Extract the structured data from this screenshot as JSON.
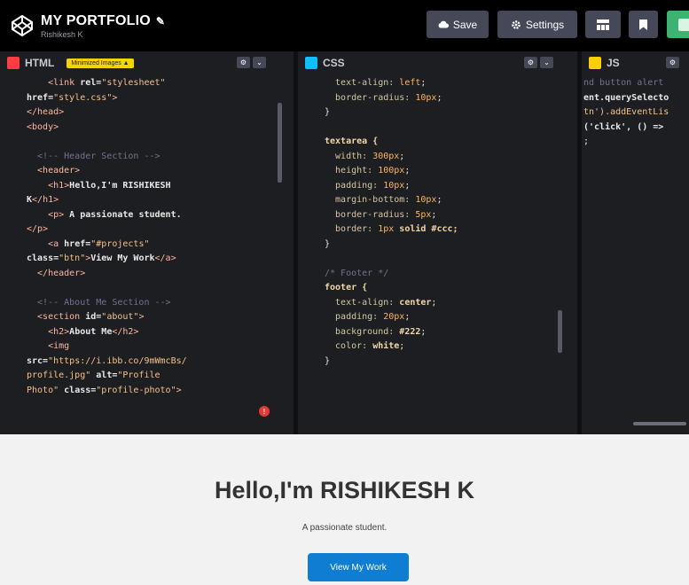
{
  "header": {
    "title": "MY PORTFOLIO",
    "pencil": "✎",
    "subtitle": "Rishikesh K",
    "save_label": "Save",
    "settings_label": "Settings",
    "save_icon": "cloud-icon",
    "settings_icon": "gear-icon"
  },
  "panes": {
    "html": {
      "label": "HTML",
      "chip": "Minimized Images ▲",
      "icon_color": "#ff3c41"
    },
    "css": {
      "label": "CSS",
      "icon_color": "#0ebeff"
    },
    "js": {
      "label": "JS",
      "icon_color": "#fcd000"
    }
  },
  "html_code": [
    [
      {
        "t": "    <link ",
        "c": "tag"
      },
      {
        "t": "rel=",
        "c": "attr"
      },
      {
        "t": "\"stylesheet\"",
        "c": "val"
      }
    ],
    [
      {
        "t": "href=",
        "c": "attr"
      },
      {
        "t": "\"style.css\"",
        "c": "val"
      },
      {
        "t": ">",
        "c": "tag"
      }
    ],
    [
      {
        "t": "</head>",
        "c": "tag"
      }
    ],
    [
      {
        "t": "<body>",
        "c": "tag"
      }
    ],
    [
      {
        "t": "",
        "c": "txt"
      }
    ],
    [
      {
        "t": "  <!-- Header Section -->",
        "c": "cmt"
      }
    ],
    [
      {
        "t": "  <header>",
        "c": "tag"
      }
    ],
    [
      {
        "t": "    <h1>",
        "c": "tag"
      },
      {
        "t": "Hello,I'm RISHIKESH",
        "c": "attr"
      }
    ],
    [
      {
        "t": "K",
        "c": "attr"
      },
      {
        "t": "</h1>",
        "c": "tag"
      }
    ],
    [
      {
        "t": "    <p>",
        "c": "tag"
      },
      {
        "t": " A passionate student.",
        "c": "attr"
      }
    ],
    [
      {
        "t": "</p>",
        "c": "tag"
      }
    ],
    [
      {
        "t": "    <a ",
        "c": "tag"
      },
      {
        "t": "href=",
        "c": "attr"
      },
      {
        "t": "\"#projects\"",
        "c": "val"
      }
    ],
    [
      {
        "t": "class=",
        "c": "attr"
      },
      {
        "t": "\"btn\"",
        "c": "val"
      },
      {
        "t": ">",
        "c": "tag"
      },
      {
        "t": "View My Work",
        "c": "attr"
      },
      {
        "t": "</a>",
        "c": "tag"
      }
    ],
    [
      {
        "t": "  </header>",
        "c": "tag"
      }
    ],
    [
      {
        "t": "",
        "c": "txt"
      }
    ],
    [
      {
        "t": "  <!-- About Me Section -->",
        "c": "cmt"
      }
    ],
    [
      {
        "t": "  <section ",
        "c": "tag"
      },
      {
        "t": "id=",
        "c": "attr"
      },
      {
        "t": "\"about\"",
        "c": "val"
      },
      {
        "t": ">",
        "c": "tag"
      }
    ],
    [
      {
        "t": "    <h2>",
        "c": "tag"
      },
      {
        "t": "About Me",
        "c": "attr"
      },
      {
        "t": "</h2>",
        "c": "tag"
      }
    ],
    [
      {
        "t": "    <img",
        "c": "tag"
      }
    ],
    [
      {
        "t": "src=",
        "c": "attr"
      },
      {
        "t": "\"https://i.ibb.co/9mWmcBs/",
        "c": "val"
      }
    ],
    [
      {
        "t": "profile.jpg\" ",
        "c": "val"
      },
      {
        "t": "alt=",
        "c": "attr"
      },
      {
        "t": "\"Profile",
        "c": "val"
      }
    ],
    [
      {
        "t": "Photo\" ",
        "c": "val"
      },
      {
        "t": "class=",
        "c": "attr"
      },
      {
        "t": "\"profile-photo\"",
        "c": "val"
      },
      {
        "t": ">",
        "c": "tag"
      }
    ]
  ],
  "css_code": [
    [
      {
        "t": "  text-align: ",
        "c": "prop"
      },
      {
        "t": "left",
        "c": "num"
      },
      {
        "t": ";",
        "c": "pun"
      }
    ],
    [
      {
        "t": "  border-radius: ",
        "c": "prop"
      },
      {
        "t": "10px",
        "c": "num"
      },
      {
        "t": ";",
        "c": "pun"
      }
    ],
    [
      {
        "t": "}",
        "c": "pun"
      }
    ],
    [
      {
        "t": "",
        "c": "txt"
      }
    ],
    [
      {
        "t": "textarea {",
        "c": "sel"
      }
    ],
    [
      {
        "t": "  width: ",
        "c": "prop"
      },
      {
        "t": "300px",
        "c": "num"
      },
      {
        "t": ";",
        "c": "pun"
      }
    ],
    [
      {
        "t": "  height: ",
        "c": "prop"
      },
      {
        "t": "100px",
        "c": "num"
      },
      {
        "t": ";",
        "c": "pun"
      }
    ],
    [
      {
        "t": "  padding: ",
        "c": "prop"
      },
      {
        "t": "10px",
        "c": "num"
      },
      {
        "t": ";",
        "c": "pun"
      }
    ],
    [
      {
        "t": "  margin-bottom: ",
        "c": "prop"
      },
      {
        "t": "10px",
        "c": "num"
      },
      {
        "t": ";",
        "c": "pun"
      }
    ],
    [
      {
        "t": "  border-radius: ",
        "c": "prop"
      },
      {
        "t": "5px",
        "c": "num"
      },
      {
        "t": ";",
        "c": "pun"
      }
    ],
    [
      {
        "t": "  border: ",
        "c": "prop"
      },
      {
        "t": "1px",
        "c": "num"
      },
      {
        "t": " solid #ccc;",
        "c": "sel"
      }
    ],
    [
      {
        "t": "}",
        "c": "pun"
      }
    ],
    [
      {
        "t": "",
        "c": "txt"
      }
    ],
    [
      {
        "t": "/* Footer */",
        "c": "cmt"
      }
    ],
    [
      {
        "t": "footer {",
        "c": "sel"
      }
    ],
    [
      {
        "t": "  text-align: ",
        "c": "prop"
      },
      {
        "t": "center",
        "c": "sel"
      },
      {
        "t": ";",
        "c": "pun"
      }
    ],
    [
      {
        "t": "  padding: ",
        "c": "prop"
      },
      {
        "t": "20px",
        "c": "num"
      },
      {
        "t": ";",
        "c": "pun"
      }
    ],
    [
      {
        "t": "  background: ",
        "c": "prop"
      },
      {
        "t": "#222",
        "c": "sel"
      },
      {
        "t": ";",
        "c": "pun"
      }
    ],
    [
      {
        "t": "  color: ",
        "c": "prop"
      },
      {
        "t": "white",
        "c": "sel"
      },
      {
        "t": ";",
        "c": "pun"
      }
    ],
    [
      {
        "t": "}",
        "c": "pun"
      }
    ]
  ],
  "js_code": [
    [
      {
        "t": "nd button alert",
        "c": "cmt"
      }
    ],
    [
      {
        "t": "ent.querySelecto",
        "c": "attr"
      }
    ],
    [
      {
        "t": "tn').addEventLis",
        "c": "val"
      }
    ],
    [
      {
        "t": "('click', () =>",
        "c": "attr"
      }
    ],
    [
      {
        "t": ";",
        "c": "pun"
      }
    ]
  ],
  "preview": {
    "heading": "Hello,I'm RISHIKESH K",
    "tagline": "A passionate student.",
    "button_label": "View My Work"
  },
  "colors": {
    "accent_button": "#0f7dd1",
    "chip": "#f5d400",
    "error_badge": "#e53935"
  }
}
